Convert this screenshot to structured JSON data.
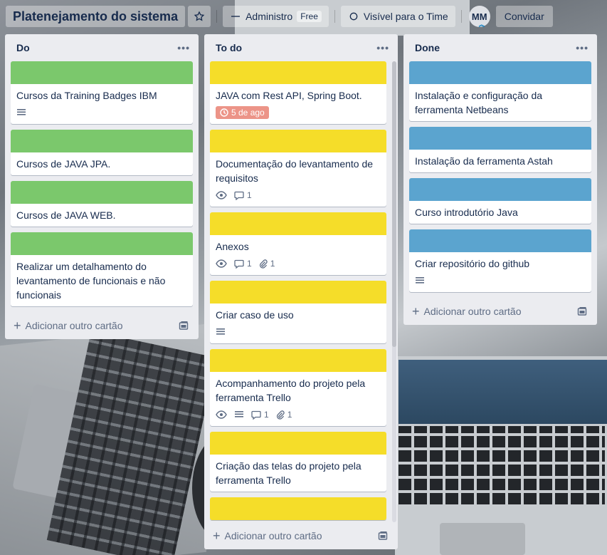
{
  "header": {
    "board_title": "Platenejamento do sistema",
    "team_label": "Administro",
    "team_plan": "Free",
    "visibility_label": "Visível para o Time",
    "avatar_initials": "MM",
    "invite_label": "Convidar"
  },
  "lists": [
    {
      "title": "Do",
      "add_card_label": "Adicionar outro cartão",
      "cards": [
        {
          "title": "Cursos da Training Badges IBM",
          "cover": "green",
          "badges": [
            "description"
          ]
        },
        {
          "title": "Cursos de JAVA JPA.",
          "cover": "green",
          "badges": []
        },
        {
          "title": "Cursos de JAVA WEB.",
          "cover": "green",
          "badges": []
        },
        {
          "title": "Realizar um detalhamento do levantamento de funcionais e não funcionais",
          "cover": "green",
          "badges": []
        }
      ]
    },
    {
      "title": "To do",
      "add_card_label": "Adicionar outro cartão",
      "cards": [
        {
          "title": "JAVA com Rest API, Spring Boot.",
          "cover": "yellow",
          "due": "5 de ago"
        },
        {
          "title": "Documentação do levantamento de requisitos",
          "cover": "yellow",
          "comments": "1"
        },
        {
          "title": "Anexos",
          "cover": "yellow",
          "comments": "1",
          "attachments": "1"
        },
        {
          "title": "Criar caso de uso",
          "cover": "yellow"
        },
        {
          "title": "Acompanhamento do projeto pela ferramenta Trello",
          "cover": "yellow",
          "comments": "1",
          "attachments": "1"
        },
        {
          "title": "Criação das telas do projeto pela ferramenta Trello",
          "cover": "yellow"
        }
      ]
    },
    {
      "title": "Done",
      "add_card_label": "Adicionar outro cartão",
      "cards": [
        {
          "title": "Instalação e configuração da ferramenta Netbeans",
          "cover": "blue"
        },
        {
          "title": "Instalação da ferramenta Astah",
          "cover": "blue"
        },
        {
          "title": "Curso introdutório Java",
          "cover": "blue"
        },
        {
          "title": "Criar repositório do github",
          "cover": "blue"
        }
      ]
    }
  ],
  "colors": {
    "cover_green": "#7bc86c",
    "cover_yellow": "#f5dd29",
    "cover_blue": "#5ba4cf",
    "due_badge": "#ec9488",
    "list_bg": "#ebecf0"
  },
  "icons": [
    "star-icon",
    "team-icon",
    "lock-globe-icon",
    "description-icon",
    "eye-icon",
    "comment-icon",
    "paperclip-icon",
    "clock-icon",
    "card-template-icon",
    "plus-icon",
    "more-icon"
  ]
}
